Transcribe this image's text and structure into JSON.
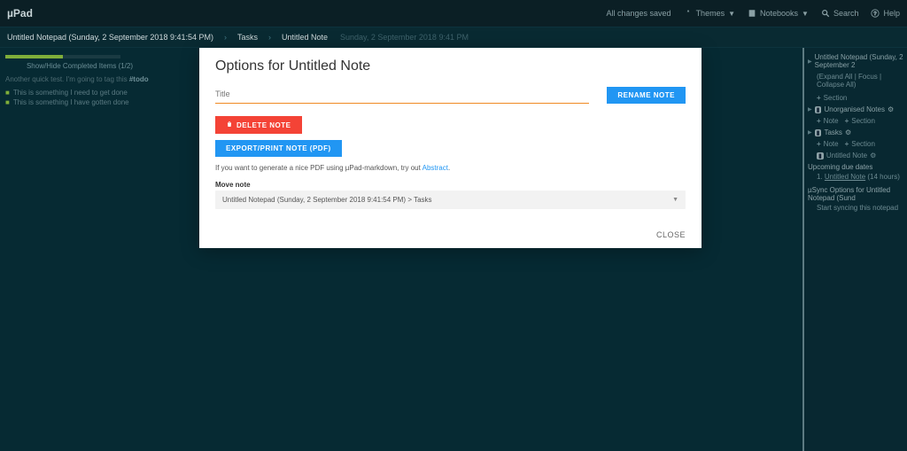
{
  "header": {
    "logo": "µPad",
    "changes": "All changes saved",
    "themes": "Themes",
    "notebooks": "Notebooks",
    "search": "Search",
    "help": "Help"
  },
  "breadcrumb": {
    "notepad": "Untitled Notepad (Sunday, 2 September 2018 9:41:54 PM)",
    "section": "Tasks",
    "note": "Untitled Note",
    "timestamp": "Sunday, 2 September 2018 9:41 PM"
  },
  "left": {
    "show_hide": "Show/Hide Completed Items (1/2)",
    "test_line_prefix": "Another quick test. I'm going to tag this ",
    "test_line_tag": "#todo",
    "tasks": [
      "This is something I need to get done",
      "This is something I have gotten done"
    ]
  },
  "sidebar": {
    "title": "Untitled Notepad (Sunday, 2 September 2",
    "controls": "(Expand All | Focus | Collapse All)",
    "add_section": "Section",
    "unorganised": "Unorganised Notes",
    "note_label": "Note",
    "section_label": "Section",
    "tasks_label": "Tasks",
    "untitled_note": "Untitled Note",
    "upcoming": "Upcoming due dates",
    "up_item": "Untitled Note",
    "up_time": "(14 hours)",
    "sync_title": "µSync Options for Untitled Notepad (Sund",
    "sync_sub": "Start syncing this notepad"
  },
  "modal": {
    "title": "Options for Untitled Note",
    "title_placeholder": "Title",
    "rename": "RENAME NOTE",
    "delete": "DELETE NOTE",
    "export": "EXPORT/PRINT NOTE (PDF)",
    "pdf_hint_pre": "If you want to generate a nice PDF using µPad-markdown, try out ",
    "pdf_hint_link": "Abstract",
    "move_label": "Move note",
    "move_value": "Untitled Notepad (Sunday, 2 September 2018 9:41:54 PM) > Tasks",
    "close": "CLOSE"
  }
}
